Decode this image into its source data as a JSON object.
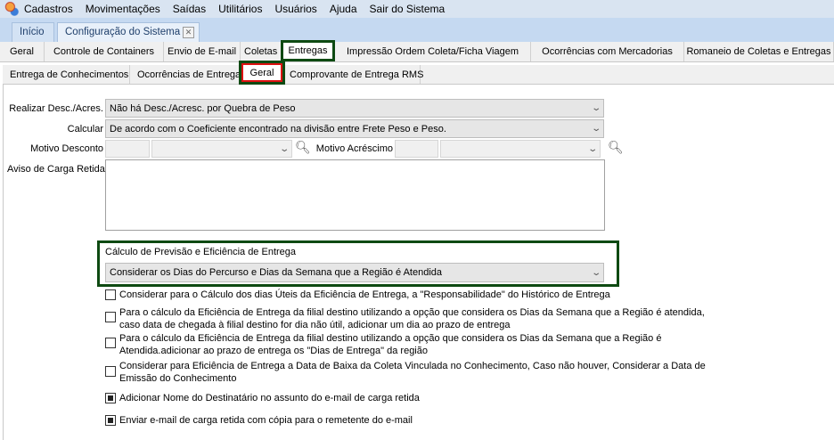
{
  "menu": {
    "items": [
      "Cadastros",
      "Movimentações",
      "Saídas",
      "Utilitários",
      "Usuários",
      "Ajuda",
      "Sair do Sistema"
    ]
  },
  "doc_tabs": [
    "Início",
    "Configuração do Sistema"
  ],
  "config_tabs": [
    "Geral",
    "Controle de Containers",
    "Envio de E-mail",
    "Coletas",
    "Entregas",
    "Impressão Ordem Coleta/Ficha Viagem",
    "Ocorrências com Mercadorias",
    "Romaneio de Coletas e Entregas"
  ],
  "sub_tabs": [
    "Entrega de Conhecimentos",
    "Ocorrências de Entrega",
    "Geral",
    "Comprovante de Entrega RMS"
  ],
  "form": {
    "realizar_label": "Realizar Desc./Acres.",
    "realizar_value": "Não há Desc./Acresc. por Quebra de Peso",
    "calcular_label": "Calcular",
    "calcular_value": "De acordo com o Coeficiente encontrado na divisão entre Frete Peso e Peso.",
    "motivo_desconto_label": "Motivo Desconto",
    "motivo_acrescimo_label": "Motivo Acréscimo",
    "aviso_label": "Aviso de Carga Retida",
    "aviso_value": "",
    "calculo_label": "Cálculo de Previsão e Eficiência de Entrega",
    "calculo_value": "Considerar os Dias do Percurso e Dias da Semana que a Região é Atendida"
  },
  "checkboxes": [
    {
      "label": "Considerar para o Cálculo dos dias Úteis da Eficiência de Entrega, a \"Responsabilidade\" do Histórico de Entrega",
      "checked": false
    },
    {
      "label": "Para o cálculo da Eficiência de Entrega da filial destino utilizando a opção que considera os Dias da Semana que a Região é atendida, caso data de chegada à filial destino for dia não útil, adicionar um dia ao prazo de entrega",
      "checked": false
    },
    {
      "label": "Para o cálculo da Eficiência de Entrega da filial destino utilizando a opção que considera os Dias da Semana que a Região é Atendida.adicionar ao prazo de entrega os \"Dias de Entrega\" da região",
      "checked": false
    },
    {
      "label": "Considerar para Eficiência de Entrega a Data de Baixa da Coleta Vinculada no Conhecimento, Caso não houver, Considerar a Data de Emissão do Conhecimento",
      "checked": false
    },
    {
      "label": "Adicionar Nome do Destinatário no assunto do e-mail de carga retida",
      "checked": true
    },
    {
      "label": "Enviar e-mail de carga retida com cópia para o remetente do e-mail",
      "checked": true
    }
  ]
}
